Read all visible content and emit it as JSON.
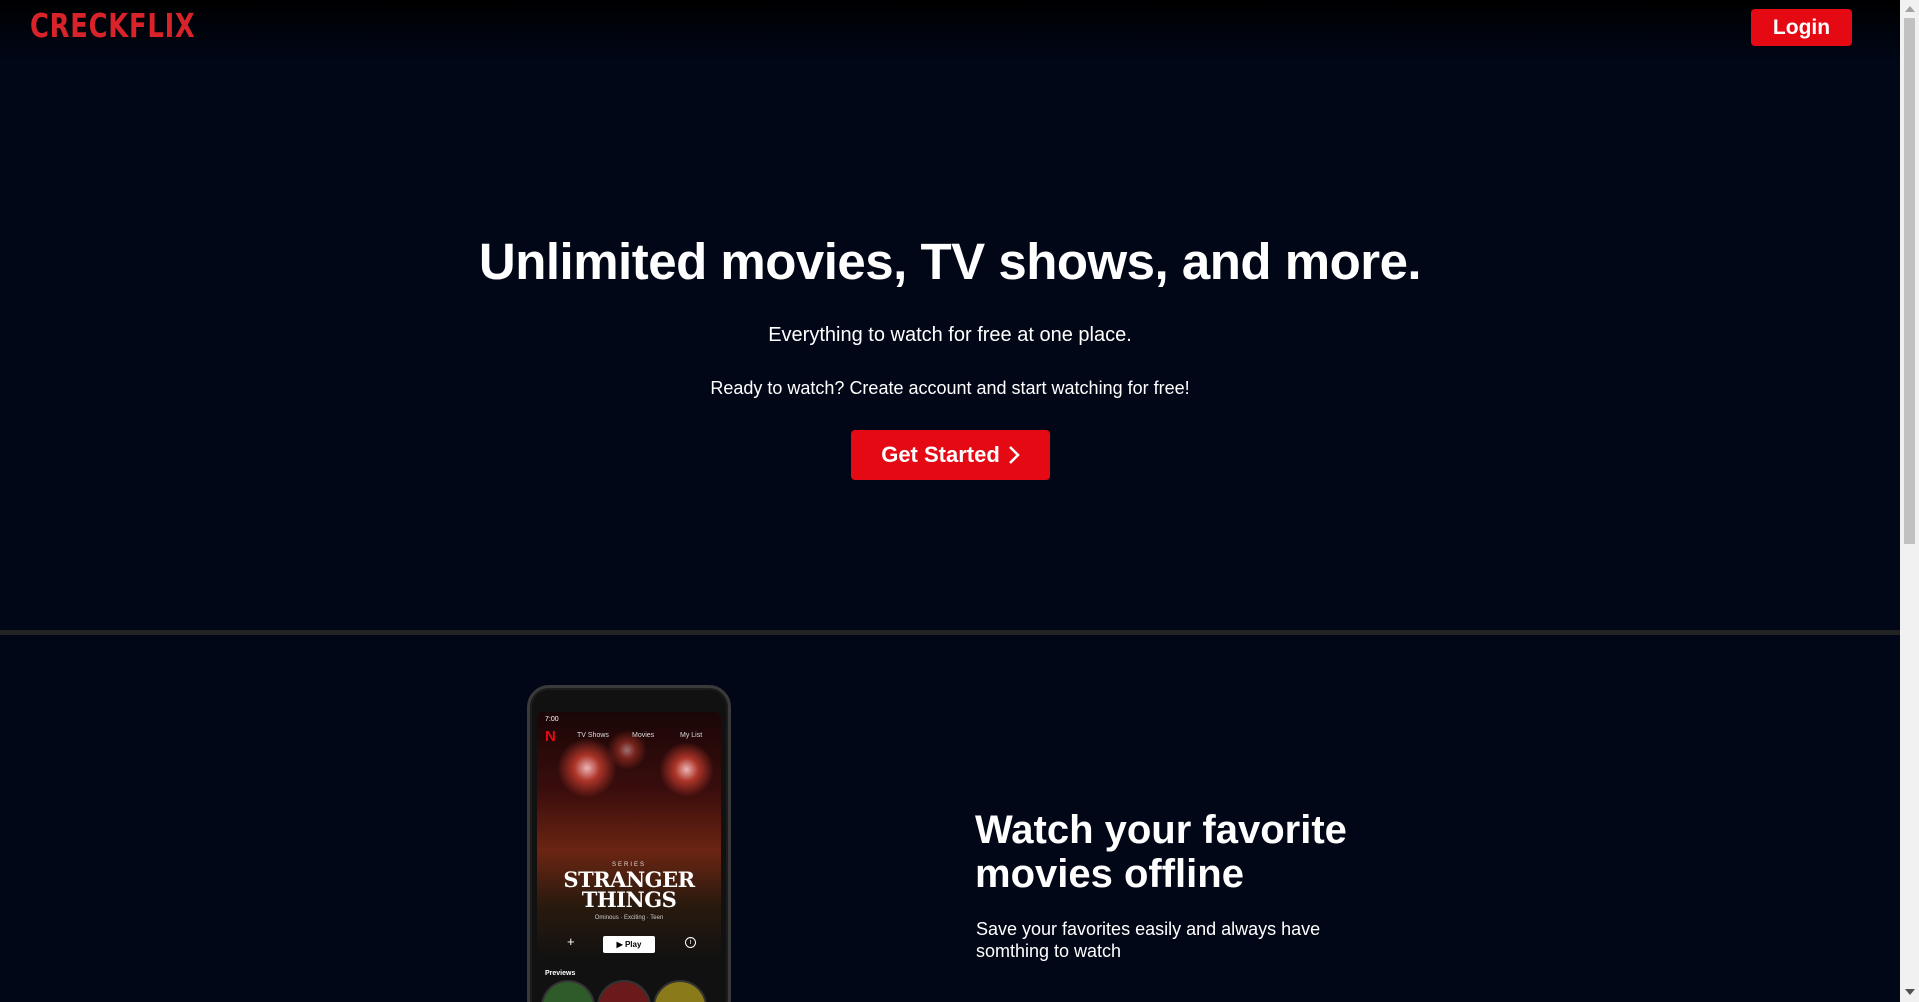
{
  "header": {
    "logo": "CRECKFLIX",
    "login_label": "Login"
  },
  "hero": {
    "title": "Unlimited movies, TV shows, and more.",
    "subtitle": "Everything to watch for free at one place.",
    "cta_text": "Ready to watch? Create account and start watching for free!",
    "get_started_label": "Get Started",
    "get_started_icon": "chevron-right-icon"
  },
  "feature": {
    "title": "Watch your favorite movies offline",
    "description": "Save your favorites easily and always have somthing to watch"
  },
  "phone": {
    "status_time": "7:00",
    "nav": [
      "TV Shows",
      "Movies",
      "My List"
    ],
    "series_label": "SERIES",
    "show_title": "STRANGER THINGS",
    "tags": "Ominous · Exciting · Teen",
    "play_label": "▶ Play",
    "previews_label": "Previews"
  },
  "colors": {
    "background": "#010717",
    "accent": "#e50914",
    "logo": "#d9232a"
  }
}
